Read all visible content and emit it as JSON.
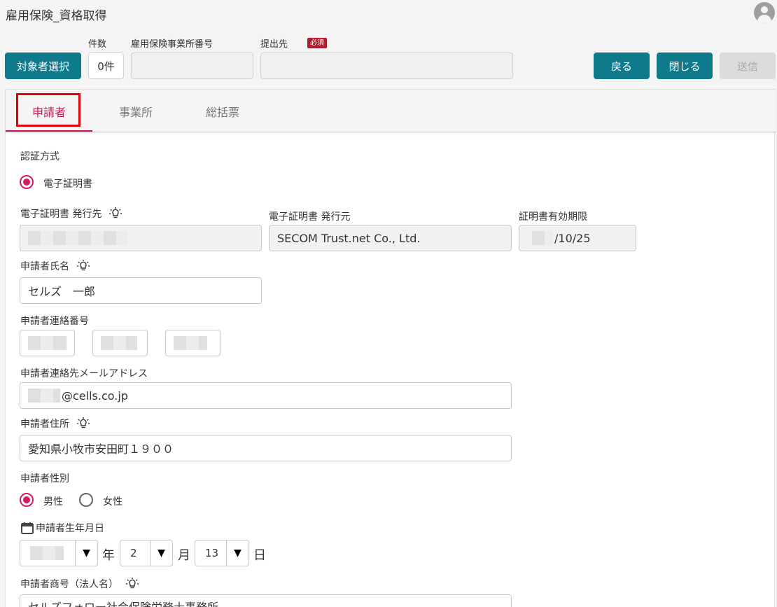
{
  "app": {
    "title": "雇用保険_資格取得"
  },
  "header": {
    "target_select_label": "対象者選択",
    "count_label": "件数",
    "count_value": "0件",
    "office_number_label": "雇用保険事業所番号",
    "office_number_value": "",
    "submit_to_label": "提出先",
    "required_badge": "必須",
    "submit_to_value": "",
    "back_label": "戻る",
    "close_label": "閉じる",
    "send_label": "送信"
  },
  "tabs": [
    {
      "label": "申請者"
    },
    {
      "label": "事業所"
    },
    {
      "label": "総括票"
    }
  ],
  "form": {
    "auth_method_label": "認証方式",
    "auth_option_label": "電子証明書",
    "cert_issued_to_label": "電子証明書 発行先",
    "cert_issuer_label": "電子証明書 発行元",
    "cert_issuer_value": "SECOM Trust.net Co., Ltd.",
    "cert_expiry_label": "証明書有効期限",
    "cert_expiry_value": "/10/25",
    "name_label": "申請者氏名",
    "name_value": "セルズ　一郎",
    "phone_label": "申請者連絡番号",
    "email_label": "申請者連絡先メールアドレス",
    "email_value": "@cells.co.jp",
    "address_label": "申請者住所",
    "address_value": "愛知県小牧市安田町１９００",
    "gender_label": "申請者性別",
    "gender_male": "男性",
    "gender_female": "女性",
    "birthdate_label": "申請者生年月日",
    "birth_year_unit": "年",
    "birth_month_value": "2",
    "birth_month_unit": "月",
    "birth_day_value": "13",
    "birth_day_unit": "日",
    "trade_name_label": "申請者商号（法人名）",
    "trade_name_value": "セルズフォロー社会保険労務士事務所"
  },
  "colors": {
    "primary_button": "#0e7a8c",
    "active_tab": "#c2185b",
    "highlight_border": "#e0000c",
    "required_badge": "#b01c2e"
  },
  "icons": [
    "user-avatar-icon",
    "lightbulb-icon",
    "calendar-icon",
    "dropdown-arrow-icon"
  ]
}
